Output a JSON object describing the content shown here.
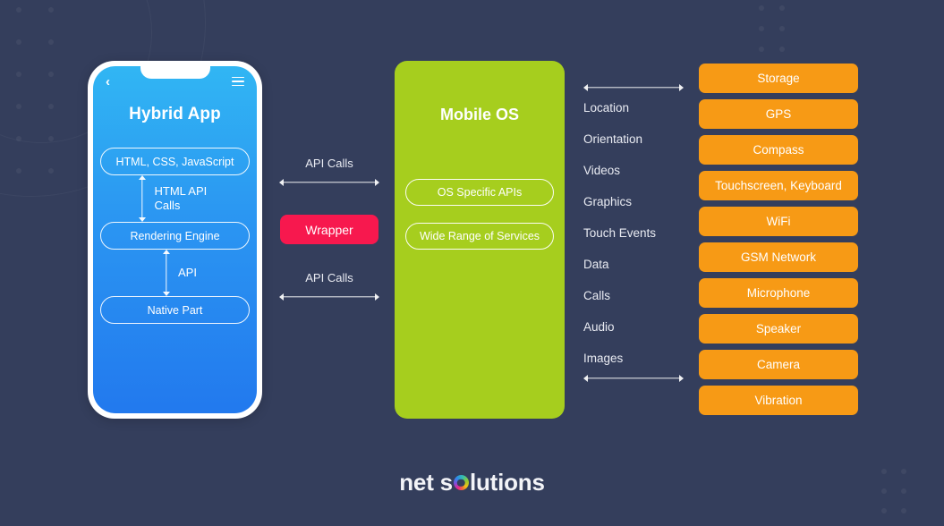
{
  "theme": {
    "background": "#343E5C",
    "phone_gradient_top": "#31B6F3",
    "phone_gradient_bottom": "#2279EE",
    "os_green": "#A6CE1E",
    "wrapper_pink": "#F7184E",
    "button_orange": "#F79A15",
    "text_light": "#E9EBF2"
  },
  "phone": {
    "back_icon": "chevron-left-icon",
    "menu_icon": "hamburger-menu-icon",
    "title": "Hybrid App",
    "pills": {
      "html_css_js": "HTML, CSS, JavaScript",
      "rendering_engine": "Rendering Engine",
      "native_part": "Native Part"
    },
    "arrows": {
      "html_api_calls": "HTML API Calls",
      "api": "API"
    }
  },
  "wrapper_column": {
    "api_calls_top": "API Calls",
    "wrapper_label": "Wrapper",
    "api_calls_bottom": "API Calls"
  },
  "mobile_os": {
    "title": "Mobile OS",
    "pills": [
      "OS Specific APIs",
      "Wide Range of Services"
    ]
  },
  "capabilities": {
    "items": [
      "Location",
      "Orientation",
      "Videos",
      "Graphics",
      "Touch Events",
      "Data",
      "Calls",
      "Audio",
      "Images"
    ]
  },
  "hardware_buttons": [
    "Storage",
    "GPS",
    "Compass",
    "Touchscreen, Keyboard",
    "WiFi",
    "GSM Network",
    "Microphone",
    "Speaker",
    "Camera",
    "Vibration"
  ],
  "logo": {
    "part1": "net s",
    "ring_icon": "multicolor-ring-icon",
    "part2": "lutions"
  }
}
